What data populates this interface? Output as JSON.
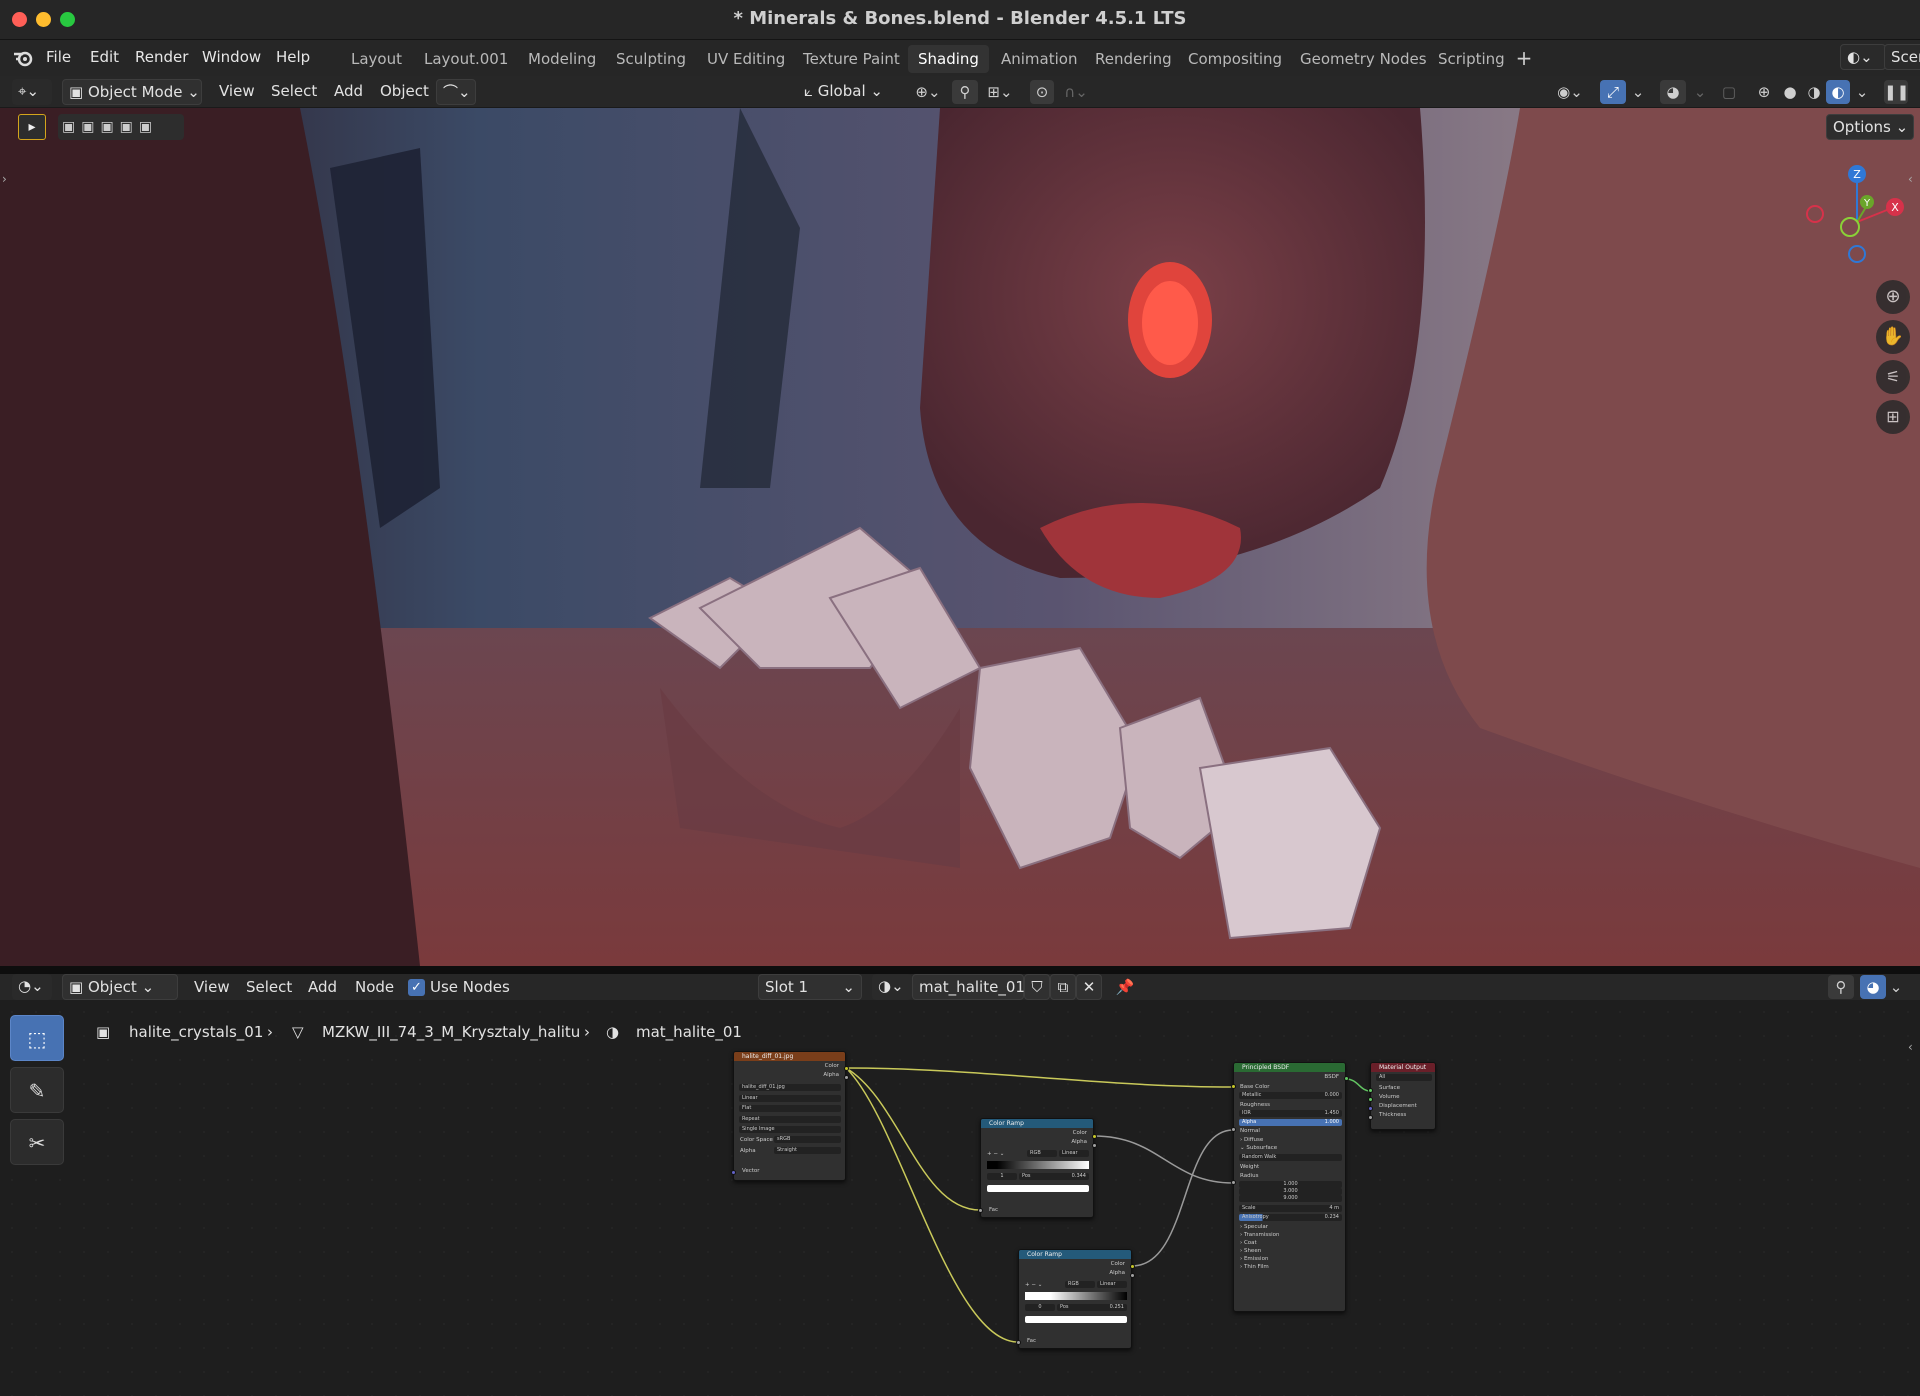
{
  "window": {
    "title": "* Minerals & Bones.blend - Blender 4.5.1 LTS"
  },
  "menu": [
    "File",
    "Edit",
    "Render",
    "Window",
    "Help"
  ],
  "workspaces": [
    "Layout",
    "Layout.001",
    "Modeling",
    "Sculpting",
    "UV Editing",
    "Texture Paint",
    "Shading",
    "Animation",
    "Rendering",
    "Compositing",
    "Geometry Nodes",
    "Scripting"
  ],
  "active_workspace": "Shading",
  "scene_label": "Scen",
  "viewport": {
    "mode": "Object Mode",
    "menus": [
      "View",
      "Select",
      "Add",
      "Object"
    ],
    "orientation": "Global",
    "options_label": "Options",
    "gizmo": {
      "z": "Z",
      "y": "Y",
      "x": "X"
    }
  },
  "node_editor": {
    "type": "Object",
    "menus": [
      "View",
      "Select",
      "Add",
      "Node"
    ],
    "use_nodes": "Use Nodes",
    "slot": "Slot 1",
    "material": "mat_halite_01",
    "breadcrumb": [
      "halite_crystals_01",
      "MZKW_III_74_3_M_Krysztaly_halitu",
      "mat_halite_01"
    ]
  },
  "nodes": {
    "image": {
      "title": "halite_diff_01.jpg",
      "out": [
        "Color",
        "Alpha"
      ],
      "file": "halite_diff_01.jpg",
      "fields": [
        "Linear",
        "Flat",
        "Repeat",
        "Single Image"
      ],
      "colorspace_label": "Color Space",
      "colorspace": "sRGB",
      "alpha_label": "Alpha",
      "alpha": "Straight",
      "in": "Vector"
    },
    "ramp1": {
      "title": "Color Ramp",
      "out": [
        "Color",
        "Alpha"
      ],
      "mode": "RGB",
      "interp": "Linear",
      "idx": "1",
      "pos_label": "Pos",
      "pos": "0.344",
      "in": "Fac"
    },
    "ramp2": {
      "title": "Color Ramp",
      "out": [
        "Color",
        "Alpha"
      ],
      "mode": "RGB",
      "interp": "Linear",
      "idx": "0",
      "pos_label": "Pos",
      "pos": "0.251",
      "in": "Fac"
    },
    "bsdf": {
      "title": "Principled BSDF",
      "out": "BSDF",
      "rows": [
        "Base Color",
        "Metallic",
        "Roughness",
        "IOR",
        "Alpha",
        "Normal",
        "Diffuse",
        "Subsurface",
        "Random Walk",
        "Weight",
        "Radius",
        "1.000",
        "3.000",
        "9.000",
        "Scale",
        "Anisotropy",
        "Specular",
        "Transmission",
        "Coat",
        "Sheen",
        "Emission",
        "Thin Film"
      ],
      "metallic": "0.000",
      "ior": "1.450",
      "alpha": "1.000",
      "scale": "4 m",
      "aniso": "0.234"
    },
    "output": {
      "title": "Material Output",
      "target": "All",
      "in": [
        "Surface",
        "Volume",
        "Displacement",
        "Thickness"
      ]
    }
  },
  "colors": {
    "accent": "#4772b3",
    "image_hdr": "#7a3e1a",
    "ramp_hdr": "#245a7a",
    "bsdf_hdr": "#2a6a33",
    "output_hdr": "#6a1f29",
    "link": "#c9c95a",
    "socket_yellow": "#c7c729",
    "socket_gray": "#a1a1a1",
    "socket_blue": "#6363c7",
    "socket_green": "#63c763"
  }
}
